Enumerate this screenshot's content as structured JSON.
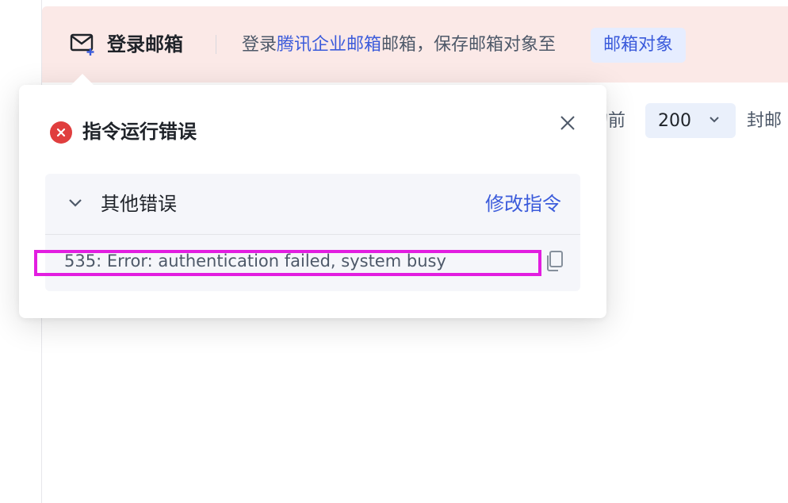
{
  "command": {
    "title": "登录邮箱",
    "desc_prefix": "登录",
    "desc_link": "腾讯企业邮箱",
    "desc_suffix": "邮箱，保存邮箱对象至",
    "target_pill": "邮箱对象"
  },
  "behind": {
    "count_prefix": "的前",
    "count_value": "200",
    "count_suffix": "封邮"
  },
  "popover": {
    "title": "指令运行错误",
    "group_title": "其他错误",
    "modify_link": "修改指令",
    "error_message": "535: Error: authentication failed, system busy"
  },
  "colors": {
    "accent": "#3b5bdb",
    "error": "#e03e3e",
    "header_bg": "#fbe9e7",
    "highlight": "#e21ee0"
  },
  "icons": {
    "mail": "mail-plus-icon",
    "error": "error-circle-icon",
    "close": "close-icon",
    "expand": "chevron-down-icon",
    "copy": "copy-icon"
  }
}
